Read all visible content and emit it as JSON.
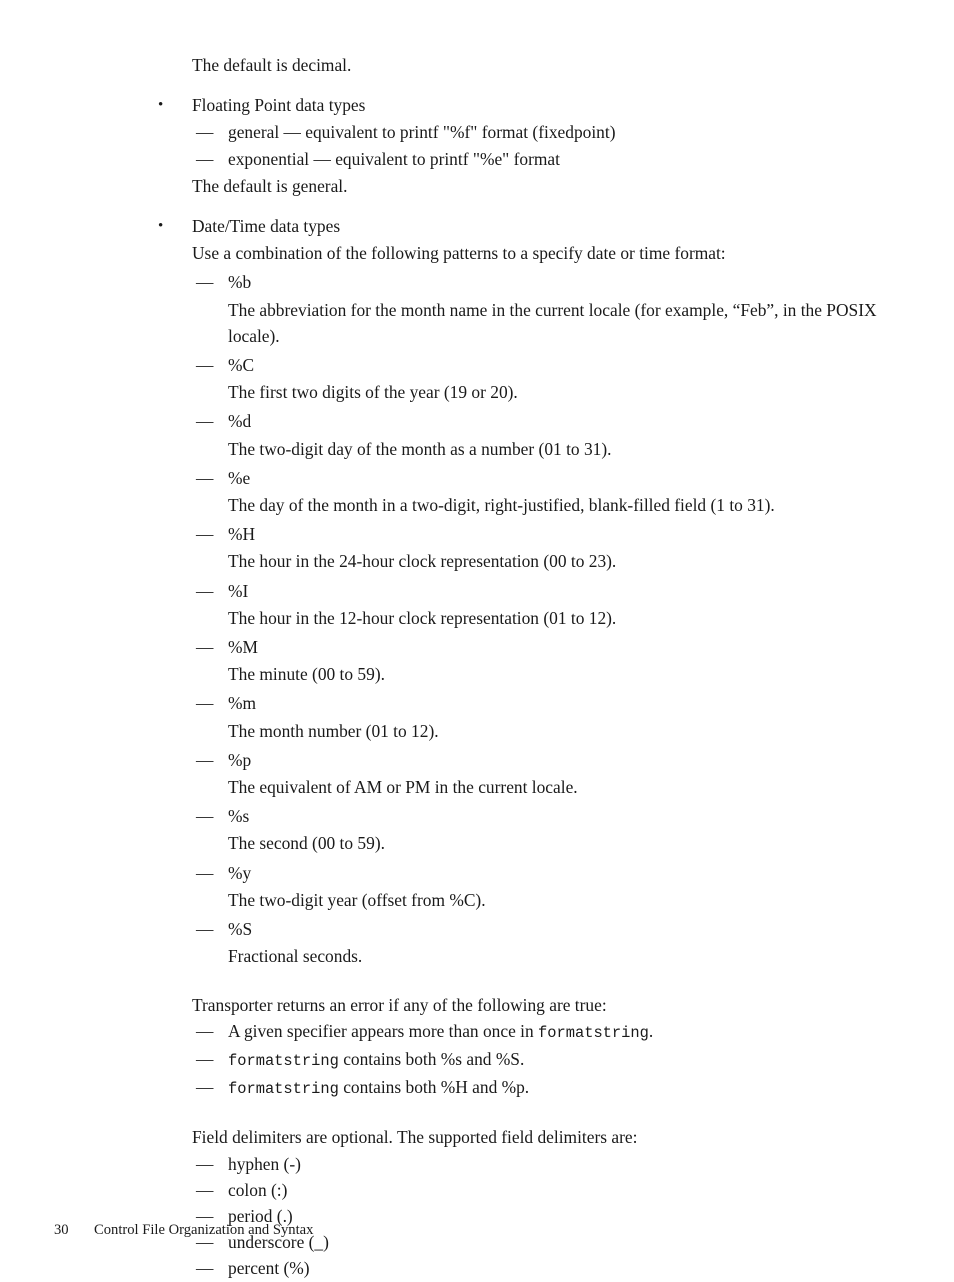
{
  "document": {
    "intro_line": "The default is decimal.",
    "sections": [
      {
        "bullet": "•",
        "heading": "Floating Point data types",
        "items": [
          "general — equivalent to printf \"%f\" format (fixedpoint)",
          "exponential — equivalent to printf \"%e\" format"
        ],
        "trailing_note": "The default is general."
      },
      {
        "bullet": "•",
        "heading": "Date/Time data types",
        "lead_in": "Use a combination of the following patterns to a specify date or time format:"
      }
    ],
    "specifiers": [
      {
        "code": "%b",
        "description": "The abbreviation for the month name in the current locale (for example, “Feb”, in the POSIX locale)."
      },
      {
        "code": "%C",
        "description": "The first two digits of the year (19 or 20)."
      },
      {
        "code": "%d",
        "description": "The two-digit day of the month as a number (01 to 31)."
      },
      {
        "code": "%e",
        "description": "The day of the month in a two-digit, right-justified, blank-filled field (1 to 31)."
      },
      {
        "code": "%H",
        "description": "The hour in the 24-hour clock representation (00 to 23)."
      },
      {
        "code": "%I",
        "description": "The hour in the 12-hour clock representation (01 to 12)."
      },
      {
        "code": "%M",
        "description": "The minute (00 to 59)."
      },
      {
        "code": "%m",
        "description": "The month number (01 to 12)."
      },
      {
        "code": "%p",
        "description": "The equivalent of AM or PM in the current locale."
      },
      {
        "code": "%s",
        "description": "The second (00 to 59)."
      },
      {
        "code": "%y",
        "description": "The two-digit year (offset from %C)."
      },
      {
        "code": "%S",
        "description": "Fractional seconds."
      }
    ],
    "error_section": {
      "lead_in": "Transporter returns an error if any of the following are true:",
      "items": [
        {
          "prefix": "A given specifier appears more than once in ",
          "code": "formatstring",
          "suffix": "."
        },
        {
          "prefix": "",
          "code": "formatstring",
          "suffix": " contains both %s and %S."
        },
        {
          "prefix": "",
          "code": "formatstring",
          "suffix": " contains both %H and %p."
        }
      ]
    },
    "delimiters_section": {
      "lead_in": "Field delimiters are optional. The supported field delimiters are:",
      "items": [
        "hyphen (-)",
        "colon (:)",
        "period (.)",
        "underscore (_)",
        "percent (%)"
      ]
    },
    "dash_marker": "—",
    "footer": {
      "page_number": "30",
      "chapter_title": "Control File Organization and Syntax"
    }
  }
}
